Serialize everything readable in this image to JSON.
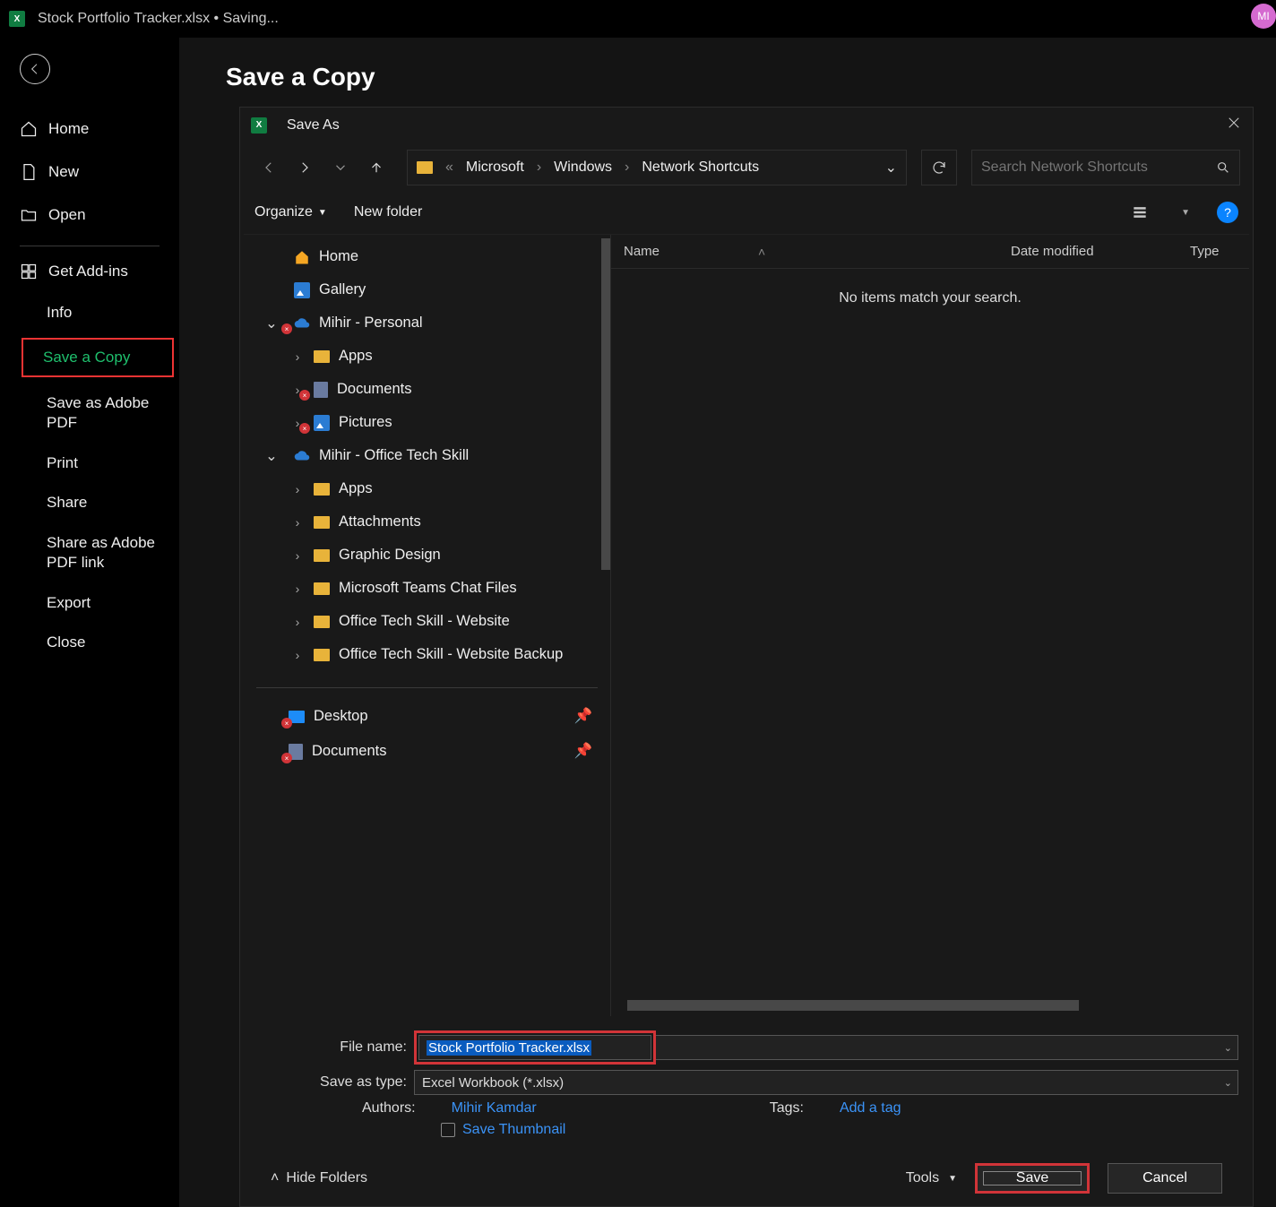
{
  "titlebar": {
    "filename": "Stock Portfolio Tracker.xlsx",
    "status": "Saving...",
    "avatar_initials": "MI"
  },
  "backstage": {
    "page_title": "Save a Copy",
    "nav": {
      "home": "Home",
      "new": "New",
      "open": "Open",
      "addins": "Get Add-ins",
      "info": "Info",
      "save_copy": "Save a Copy",
      "save_adobe": "Save as Adobe PDF",
      "print": "Print",
      "share": "Share",
      "share_adobe": "Share as Adobe PDF link",
      "export": "Export",
      "close": "Close"
    }
  },
  "dialog": {
    "title": "Save As",
    "breadcrumb": {
      "prefix": "«",
      "items": [
        "Microsoft",
        "Windows",
        "Network Shortcuts"
      ]
    },
    "search_placeholder": "Search Network Shortcuts",
    "subbar": {
      "organize": "Organize",
      "new_folder": "New folder"
    },
    "tree": {
      "home": "Home",
      "gallery": "Gallery",
      "personal": "Mihir - Personal",
      "personal_children": [
        "Apps",
        "Documents",
        "Pictures"
      ],
      "work": "Mihir - Office Tech Skill",
      "work_children": [
        "Apps",
        "Attachments",
        "Graphic Design",
        "Microsoft Teams Chat Files",
        "Office Tech Skill - Website",
        "Office Tech Skill - Website Backup"
      ],
      "quick": [
        "Desktop",
        "Documents"
      ]
    },
    "columns": {
      "name": "Name",
      "date": "Date modified",
      "type": "Type"
    },
    "empty_message": "No items match your search.",
    "file_name_label": "File name:",
    "file_name_value": "Stock Portfolio Tracker.xlsx",
    "save_type_label": "Save as type:",
    "save_type_value": "Excel Workbook (*.xlsx)",
    "authors_label": "Authors:",
    "authors_value": "Mihir Kamdar",
    "tags_label": "Tags:",
    "tags_value": "Add a tag",
    "thumbnail_label": "Save Thumbnail",
    "hide_folders": "Hide Folders",
    "tools": "Tools",
    "save": "Save",
    "cancel": "Cancel"
  }
}
